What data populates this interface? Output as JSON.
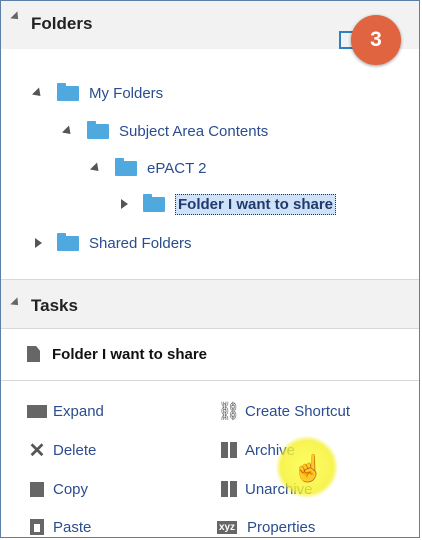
{
  "folders_panel": {
    "title": "Folders",
    "badge": "3",
    "tree": [
      {
        "label": "My Folders",
        "state": "open"
      },
      {
        "label": "Subject Area Contents",
        "state": "open"
      },
      {
        "label": "ePACT 2",
        "state": "open"
      },
      {
        "label": "Folder I want to share",
        "state": "closed",
        "selected": true
      },
      {
        "label": "Shared Folders",
        "state": "closed"
      }
    ]
  },
  "tasks_panel": {
    "title": "Tasks",
    "context": "Folder I want to share",
    "actions": [
      {
        "label": "Expand",
        "icon": "folder-open-icon"
      },
      {
        "label": "Create Shortcut",
        "icon": "link-icon"
      },
      {
        "label": "Delete",
        "icon": "delete-x-icon"
      },
      {
        "label": "Archive",
        "icon": "archive-icon"
      },
      {
        "label": "Copy",
        "icon": "copy-icon"
      },
      {
        "label": "Unarchive",
        "icon": "unarchive-icon"
      },
      {
        "label": "Paste",
        "icon": "paste-icon"
      },
      {
        "label": "Properties",
        "icon": "xyz-properties-icon"
      }
    ]
  },
  "colors": {
    "link": "#2a4d8f",
    "badge": "#e0643f",
    "folder": "#4fa8de",
    "selection": "#cfe2f7"
  }
}
